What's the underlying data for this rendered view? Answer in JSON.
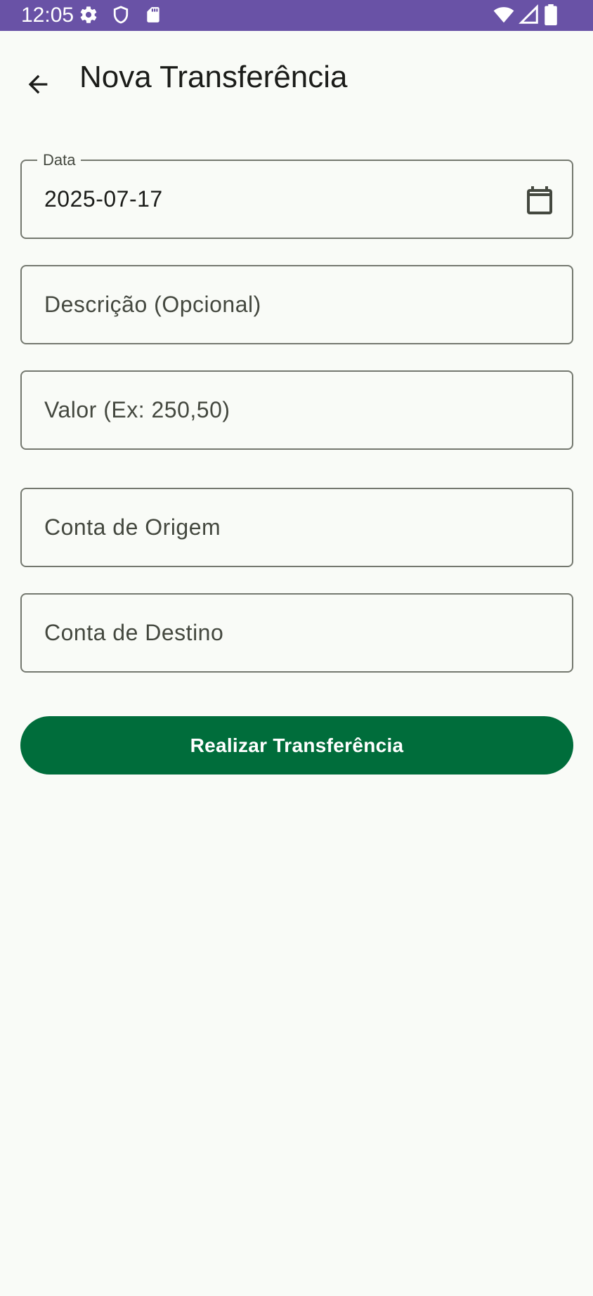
{
  "status_bar": {
    "time": "12:05",
    "icons": [
      "gear-icon",
      "shield-icon",
      "sd-card-icon",
      "wifi-icon",
      "signal-icon",
      "battery-icon"
    ],
    "background_color": "#6952a6"
  },
  "app_bar": {
    "title": "Nova Transferência",
    "back_icon": "arrow-back-icon"
  },
  "form": {
    "date": {
      "label": "Data",
      "value": "2025-07-17",
      "icon": "calendar-icon"
    },
    "description": {
      "placeholder": "Descrição (Opcional)"
    },
    "amount": {
      "placeholder": "Valor (Ex: 250,50)"
    },
    "origin_account": {
      "placeholder": "Conta de Origem"
    },
    "destination_account": {
      "placeholder": "Conta de Destino"
    }
  },
  "actions": {
    "submit_label": "Realizar Transferência",
    "submit_color": "#006d3b"
  }
}
